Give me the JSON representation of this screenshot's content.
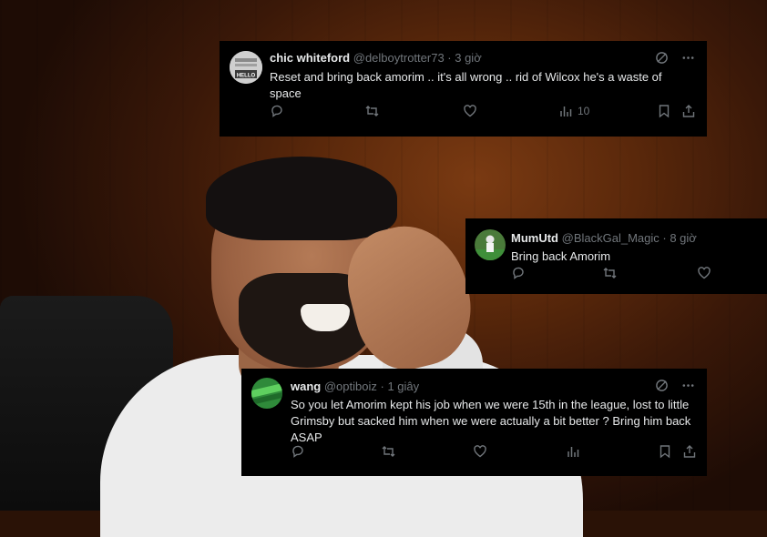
{
  "tweets": [
    {
      "author": "chic whiteford",
      "handle": "@delboytrotter73",
      "time": "· 3 giờ",
      "text": "Reset and bring back amorim .. it's all wrong .. rid of Wilcox he's a waste of space",
      "views": "10",
      "avatar_text": "HELLO"
    },
    {
      "author": "MumUtd",
      "handle": "@BlackGal_Magic",
      "time": "· 8 giờ",
      "text": "Bring back Amorim"
    },
    {
      "author": "wang",
      "handle": "@optiboiz",
      "time": "· 1 giây",
      "text": "So you let Amorim kept his job when we were 15th in the league, lost to little Grimsby but sacked him when we were actually a bit better ? Bring him back ASAP"
    }
  ],
  "colors": {
    "card_bg": "#000000",
    "text": "#e7e9ea",
    "muted": "#71767b"
  },
  "icons": [
    "reply-icon",
    "retweet-icon",
    "like-icon",
    "views-icon",
    "bookmark-icon",
    "share-icon",
    "grok-icon",
    "more-icon"
  ]
}
